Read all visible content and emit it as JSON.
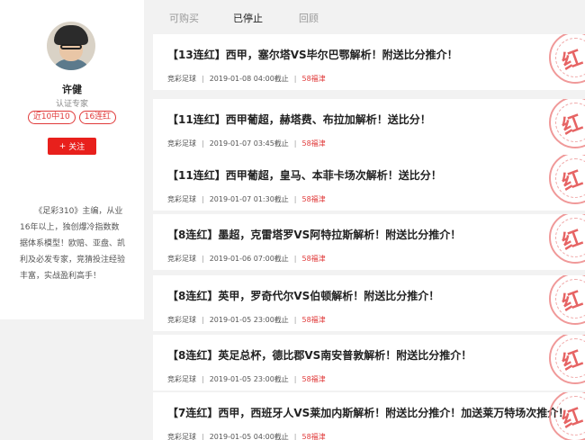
{
  "profile": {
    "name": "许健",
    "title": "认证专家",
    "badges": [
      "近10中10",
      "16连红"
    ],
    "follow_label": "关注",
    "bio": "《足彩310》主编，从业16年以上，独创爆冷指数数据体系模型！欧赔、亚盘、凯利及必发专家，竞猜投注经验丰富，实战盈利高手！"
  },
  "tabs": [
    {
      "label": "可购买"
    },
    {
      "label": "已停止"
    },
    {
      "label": "回顾"
    }
  ],
  "articles": [
    {
      "title": "【13连红】西甲，塞尔塔VS毕尔巴鄂解析！附送比分推介！",
      "category": "竞彩足球",
      "time": "2019-01-08 04:00截止",
      "price": "58福津",
      "stamp": "红"
    },
    {
      "title": "【11连红】西甲葡超，赫塔费、布拉加解析！送比分！",
      "category": "竞彩足球",
      "time": "2019-01-07 03:45截止",
      "price": "58福津",
      "stamp": "红"
    },
    {
      "title": "【11连红】西甲葡超，皇马、本菲卡场次解析！送比分！",
      "category": "竞彩足球",
      "time": "2019-01-07 01:30截止",
      "price": "58福津",
      "stamp": "红"
    },
    {
      "title": "【8连红】墨超，克雷塔罗VS阿特拉斯解析！附送比分推介！",
      "category": "竞彩足球",
      "time": "2019-01-06 07:00截止",
      "price": "58福津",
      "stamp": "红"
    },
    {
      "title": "【8连红】英甲，罗奇代尔VS伯顿解析！附送比分推介！",
      "category": "竞彩足球",
      "time": "2019-01-05 23:00截止",
      "price": "58福津",
      "stamp": "红"
    },
    {
      "title": "【8连红】英足总杯，德比郡VS南安普敦解析！附送比分推介！",
      "category": "竞彩足球",
      "time": "2019-01-05 23:00截止",
      "price": "58福津",
      "stamp": "红"
    },
    {
      "title": "【7连红】西甲，西班牙人VS莱加内斯解析！附送比分推介！加送莱万特场次推介！",
      "category": "竞彩足球",
      "time": "2019-01-05 04:00截止",
      "price": "58福津",
      "stamp": "红"
    }
  ]
}
